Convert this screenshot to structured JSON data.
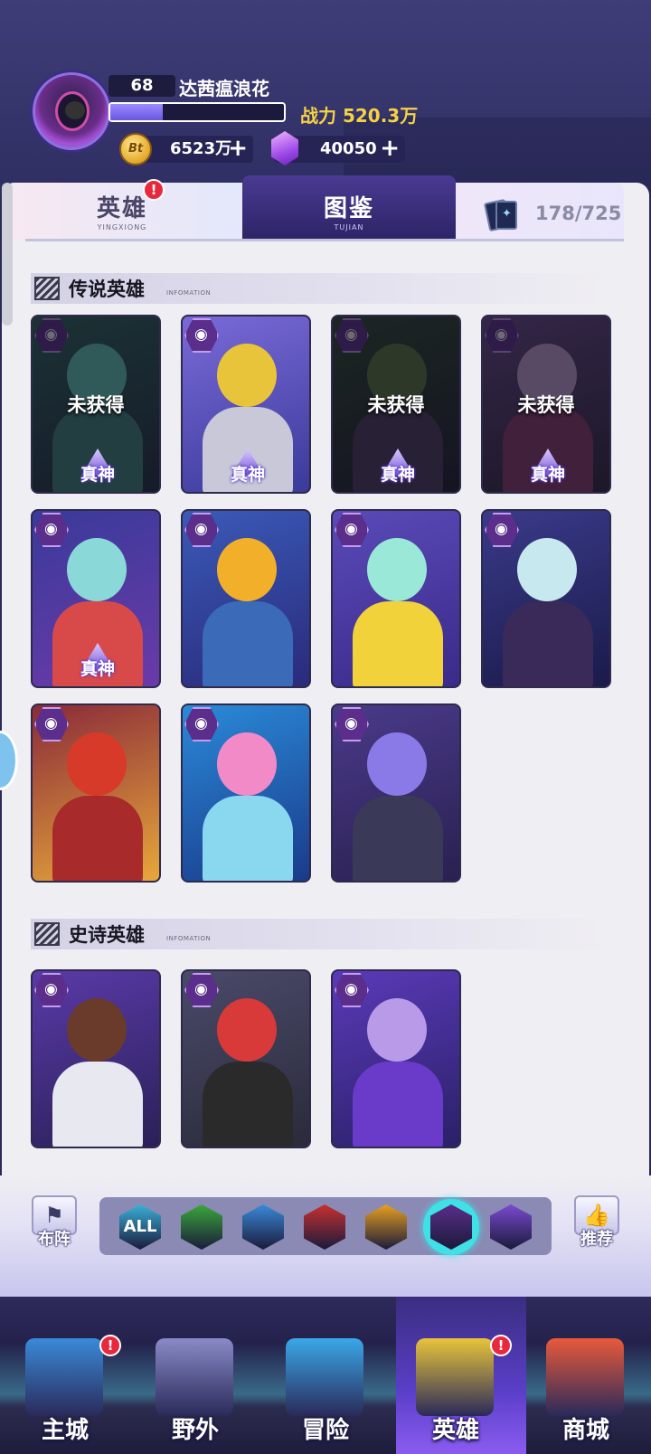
{
  "player": {
    "level": "68",
    "name": "达茜瘟浪花",
    "power_label": "战力 520.3万",
    "exp_progress": 0.3
  },
  "resources": {
    "coins": "6523万",
    "coin_symbol": "Bt",
    "gems": "40050",
    "plus": "+"
  },
  "tabs": {
    "hero": {
      "label": "英雄",
      "sub": "YINGXIONG",
      "badge": "!"
    },
    "codex": {
      "label": "图鉴",
      "sub": "TUJIAN"
    },
    "collection_count": "178/725"
  },
  "sections": [
    {
      "title": "传说英雄",
      "sub": "INFOMATION"
    },
    {
      "title": "史诗英雄",
      "sub": "INFOMATION"
    }
  ],
  "labels": {
    "not_obtained": "未获得",
    "true_god": "真神"
  },
  "heroes_legend": [
    {
      "state": "locked",
      "badge": "真神"
    },
    {
      "state": "owned",
      "badge": "真神"
    },
    {
      "state": "locked",
      "badge": "真神"
    },
    {
      "state": "locked",
      "badge": "真神"
    },
    {
      "state": "owned",
      "badge": "真神"
    },
    {
      "state": "owned"
    },
    {
      "state": "owned"
    },
    {
      "state": "owned"
    },
    {
      "state": "owned"
    },
    {
      "state": "owned"
    },
    {
      "state": "owned"
    }
  ],
  "heroes_epic": [
    {
      "state": "owned"
    },
    {
      "state": "owned"
    },
    {
      "state": "owned"
    }
  ],
  "filters": {
    "left_button": "布阵",
    "right_button": "推荐",
    "items": [
      {
        "name": "all-filter",
        "label": "ALL",
        "color": "#3ab0d8"
      },
      {
        "name": "nature-filter",
        "label": "",
        "color": "#3aa83a"
      },
      {
        "name": "water-filter",
        "label": "",
        "color": "#3a8ad8"
      },
      {
        "name": "fire-filter",
        "label": "",
        "color": "#c83030"
      },
      {
        "name": "light-filter",
        "label": "",
        "color": "#e8a020"
      },
      {
        "name": "dark-filter",
        "label": "",
        "color": "#5a2e8a",
        "selected": true
      },
      {
        "name": "void-filter",
        "label": "",
        "color": "#7a4ad0"
      }
    ]
  },
  "nav": [
    {
      "label": "主城",
      "badge": "!"
    },
    {
      "label": "野外"
    },
    {
      "label": "冒险"
    },
    {
      "label": "英雄",
      "badge": "!",
      "active": true
    },
    {
      "label": "商城"
    }
  ]
}
